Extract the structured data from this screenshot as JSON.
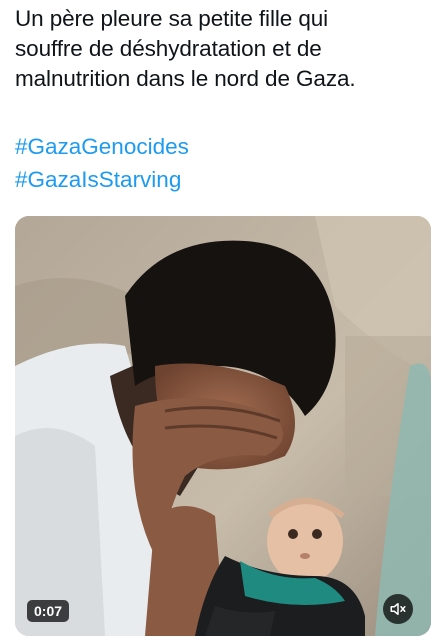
{
  "tweet": {
    "text_lines": [
      "Un père pleure sa petite fille qui",
      "souffre de déshydratation et de",
      "malnutrition dans le nord de Gaza."
    ],
    "hashtags": [
      "#GazaGenocides",
      "#GazaIsStarving"
    ]
  },
  "video": {
    "duration": "0:07",
    "mute_icon": "speaker-muted-icon"
  },
  "colors": {
    "text": "#0f1419",
    "link": "#1d9bf0",
    "overlay": "rgba(0,0,0,0.72)"
  }
}
